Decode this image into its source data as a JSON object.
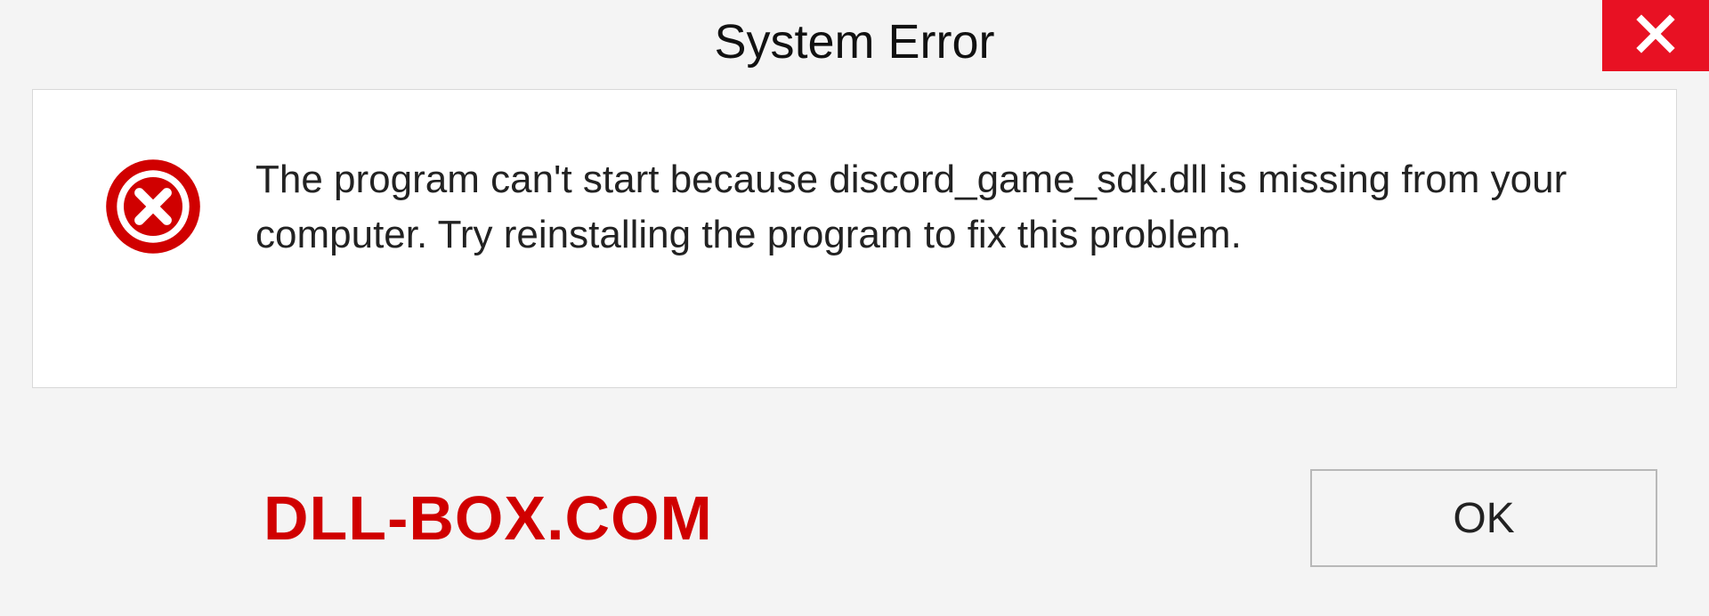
{
  "dialog": {
    "title": "System Error",
    "message": "The program can't start because discord_game_sdk.dll is missing from your computer. Try reinstalling the program to fix this problem.",
    "ok_label": "OK"
  },
  "watermark": "DLL-BOX.COM",
  "colors": {
    "close_bg": "#e81123",
    "error_icon": "#d00000",
    "watermark": "#d00000"
  }
}
